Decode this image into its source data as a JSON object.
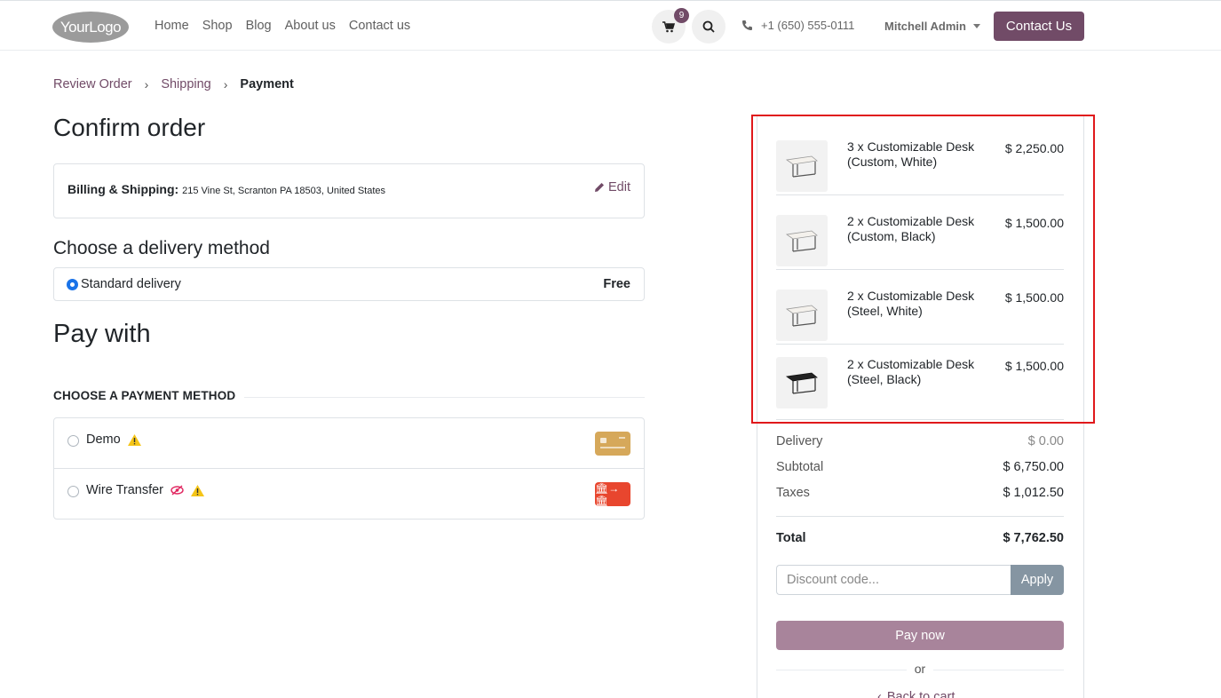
{
  "header": {
    "logo_text": "YourLogo",
    "nav": [
      "Home",
      "Shop",
      "Blog",
      "About us",
      "Contact us"
    ],
    "cart_count": "9",
    "phone": "+1 (650) 555-0111",
    "user": "Mitchell Admin",
    "contact_button": "Contact Us",
    "accent_color": "#714b67"
  },
  "breadcrumb": {
    "step1": "Review Order",
    "step2": "Shipping",
    "step3": "Payment"
  },
  "main": {
    "title": "Confirm order",
    "billing_label": "Billing & Shipping:",
    "billing_address": "215 Vine St, Scranton PA 18503, United States",
    "edit_label": "Edit",
    "delivery_heading": "Choose a delivery method",
    "delivery_option": "Standard delivery",
    "delivery_price": "Free",
    "pay_heading": "Pay with",
    "payment_heading": "CHOOSE A PAYMENT METHOD",
    "payment_methods": [
      {
        "label": "Demo"
      },
      {
        "label": "Wire Transfer"
      }
    ]
  },
  "summary": {
    "items": [
      {
        "name": "3 x Customizable Desk (Custom, White)",
        "price": "$ 2,250.00",
        "variant": "white"
      },
      {
        "name": "2 x Customizable Desk (Custom, Black)",
        "price": "$ 1,500.00",
        "variant": "white"
      },
      {
        "name": "2 x Customizable Desk (Steel, White)",
        "price": "$ 1,500.00",
        "variant": "white"
      },
      {
        "name": "2 x Customizable Desk (Steel, Black)",
        "price": "$ 1,500.00",
        "variant": "black"
      }
    ],
    "delivery_label": "Delivery",
    "delivery_value": "$ 0.00",
    "subtotal_label": "Subtotal",
    "subtotal_value": "$ 6,750.00",
    "taxes_label": "Taxes",
    "taxes_value": "$ 1,012.50",
    "total_label": "Total",
    "total_value": "$ 7,762.50",
    "discount_placeholder": "Discount code...",
    "apply_label": "Apply",
    "pay_now_label": "Pay now",
    "or_label": "or",
    "back_label": "Back to cart"
  }
}
